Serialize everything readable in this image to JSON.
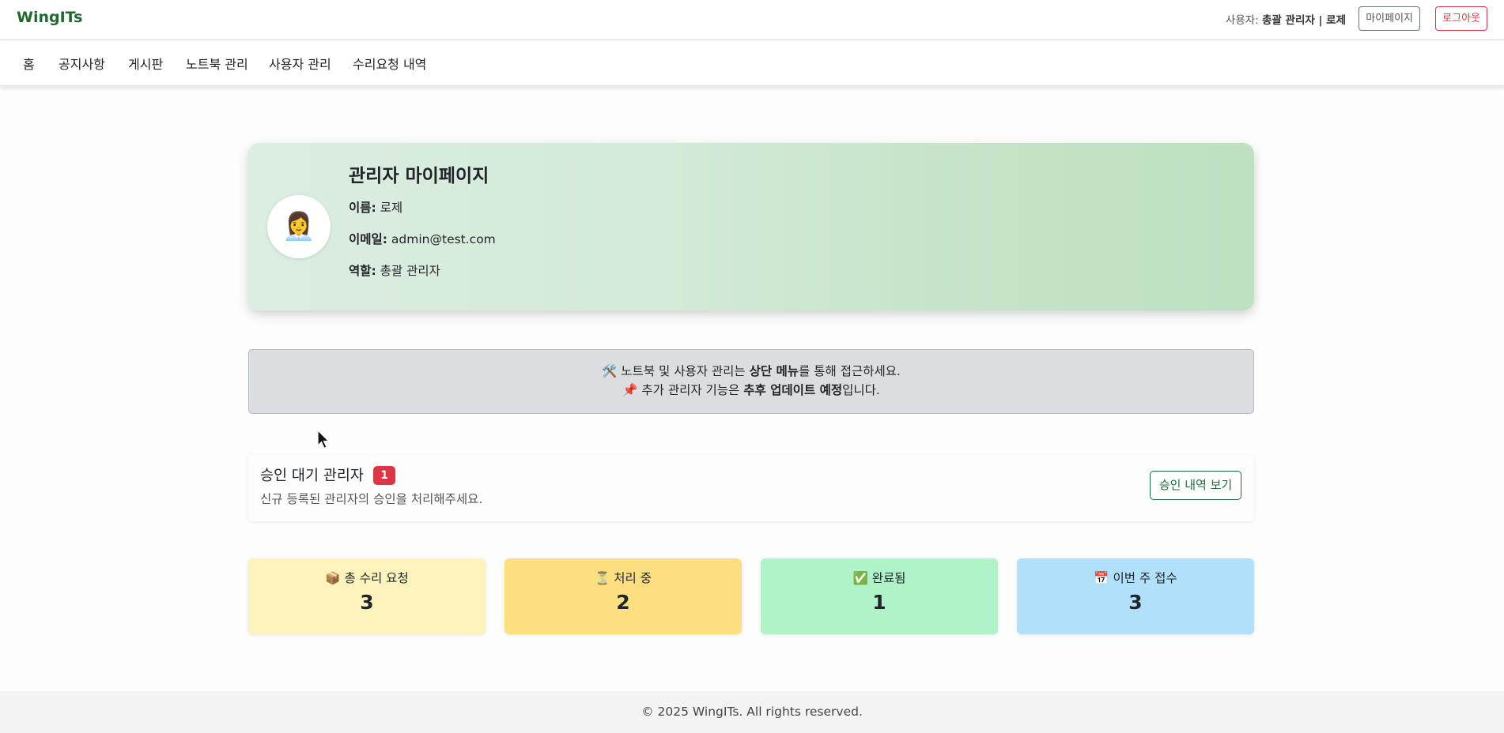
{
  "header": {
    "brand": "WingITs",
    "user_prefix": "사용자:",
    "user_role_name": "총괄 관리자 | 로제",
    "mypage_label": "마이페이지",
    "logout_label": "로그아웃"
  },
  "nav": {
    "items": [
      {
        "label": "홈"
      },
      {
        "label": "공지사항"
      },
      {
        "label": "게시판"
      },
      {
        "label": "노트북 관리"
      },
      {
        "label": "사용자 관리"
      },
      {
        "label": "수리요청 내역"
      }
    ]
  },
  "profile": {
    "avatar_emoji": "👩‍💼",
    "title": "관리자 마이페이지",
    "name_label": "이름:",
    "name_value": "로제",
    "email_label": "이메일:",
    "email_value": "admin@test.com",
    "role_label": "역할:",
    "role_value": "총괄 관리자"
  },
  "info": {
    "line1_icon": "🛠️",
    "line1_pre": " 노트북 및 사용자 관리는 ",
    "line1_bold": "상단 메뉴",
    "line1_post": "를 통해 접근하세요.",
    "line2_icon": "📌",
    "line2_pre": " 추가 관리자 기능은 ",
    "line2_bold": "추후 업데이트 예정",
    "line2_post": "입니다."
  },
  "pending": {
    "title": "승인 대기 관리자",
    "count": "1",
    "description": "신규 등록된 관리자의 승인을 처리해주세요.",
    "button_label": "승인 내역 보기"
  },
  "stats": [
    {
      "icon": "📦",
      "label": "총 수리 요청",
      "value": "3",
      "color": "#fcf4bc"
    },
    {
      "icon": "⏳",
      "label": "처리 중",
      "value": "2",
      "color": "#fcdf81"
    },
    {
      "icon": "✅",
      "label": "완료됨",
      "value": "1",
      "color": "#b1f3c8"
    },
    {
      "icon": "📅",
      "label": "이번 주 접수",
      "value": "3",
      "color": "#b1e0fb"
    }
  ],
  "footer": {
    "text": "© 2025 WingITs. All rights reserved."
  }
}
